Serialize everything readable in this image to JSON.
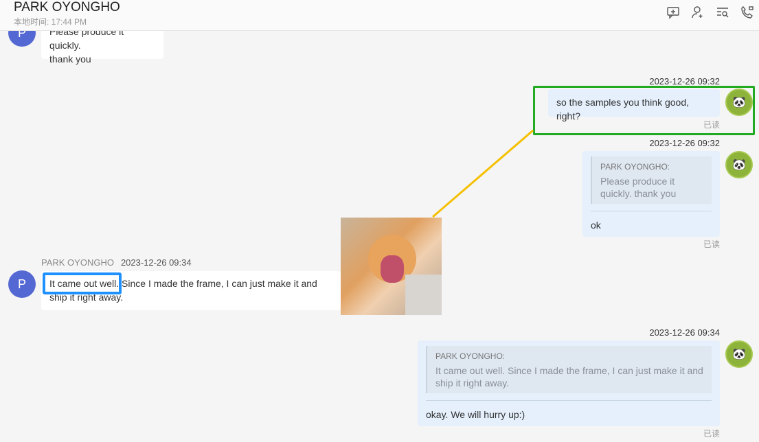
{
  "header": {
    "title": "PARK OYONGHO",
    "local_time": "本地时间: 17:44 PM",
    "icons": [
      "add-chat-icon",
      "add-member-icon",
      "search-history-icon",
      "call-icon"
    ]
  },
  "contact": {
    "initial": "P",
    "name": "PARK OYONGHO"
  },
  "messages": [
    {
      "side": "left",
      "text_line1": "Please produce it quickly.",
      "text_line2": "thank you"
    },
    {
      "side": "right",
      "timestamp": "2023-12-26 09:32",
      "text": "so the samples you think good, right?",
      "status": "已读"
    },
    {
      "side": "right",
      "timestamp": "2023-12-26 09:32",
      "quote_name": "PARK OYONGHO:",
      "quote_text": "Please produce it quickly. thank you",
      "text": "ok",
      "status": "已读"
    },
    {
      "side": "left",
      "sender": "PARK OYONGHO",
      "timestamp": "2023-12-26 09:34",
      "text": "It came out well. Since I made the frame, I can just make it and ship it right away."
    },
    {
      "side": "right",
      "timestamp": "2023-12-26 09:34",
      "quote_name": "PARK OYONGHO:",
      "quote_text": "It came out well. Since I made the frame, I can just make it and ship it right away.",
      "text": "okay. We will hurry up:)",
      "status": "已读"
    }
  ],
  "annotation_colors": {
    "green": "#22aa22",
    "blue": "#1e90ff",
    "yellow": "#f5c000"
  }
}
